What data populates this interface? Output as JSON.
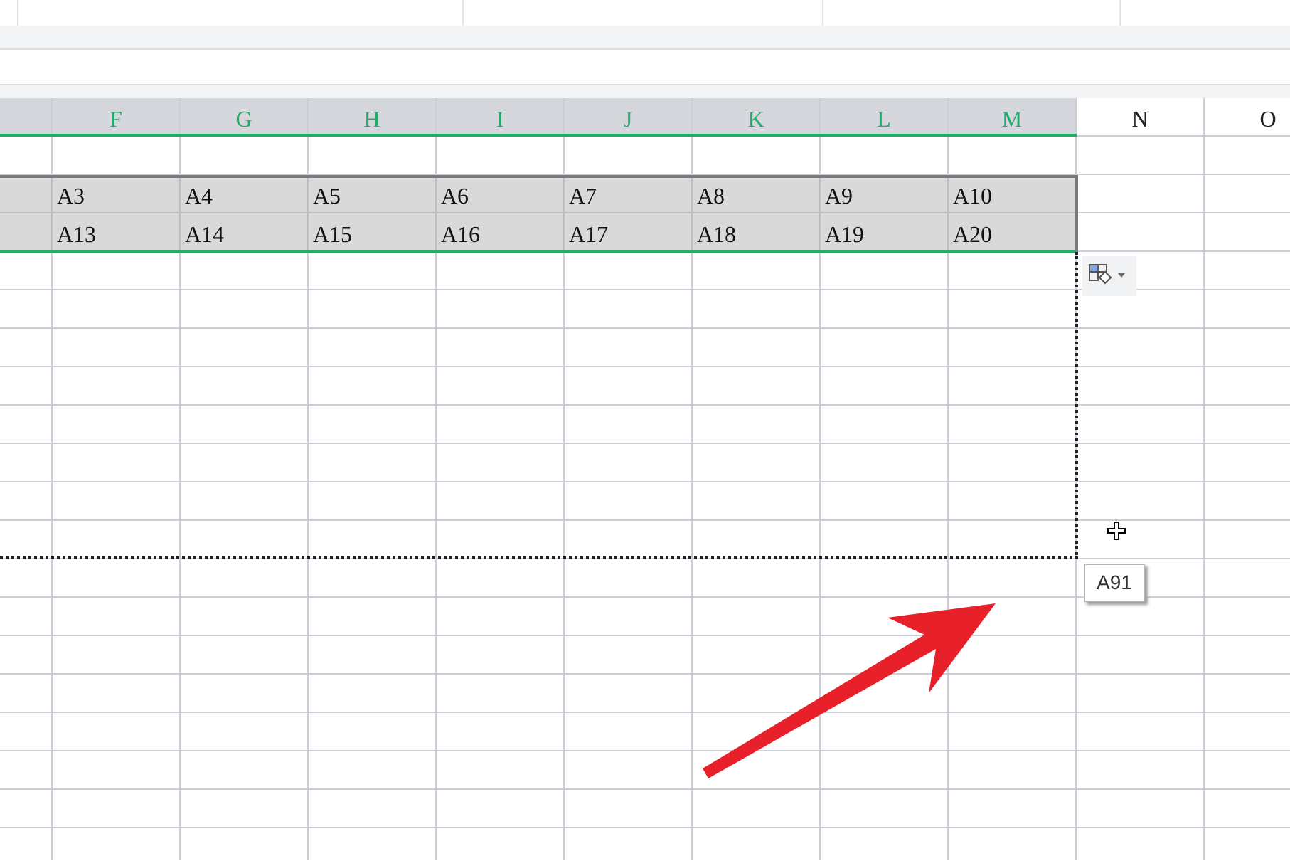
{
  "columns": [
    {
      "selected": true
    },
    {
      "label": "F",
      "selected": true
    },
    {
      "label": "G",
      "selected": true
    },
    {
      "label": "H",
      "selected": true
    },
    {
      "label": "I",
      "selected": true
    },
    {
      "label": "J",
      "selected": true
    },
    {
      "label": "K",
      "selected": true
    },
    {
      "label": "L",
      "selected": true
    },
    {
      "label": "M",
      "selected": true
    },
    {
      "label": "N",
      "selected": false
    },
    {
      "label": "O",
      "selected": false
    }
  ],
  "filled_rows": [
    {
      "selected": true,
      "cells": [
        "A3",
        "A4",
        "A5",
        "A6",
        "A7",
        "A8",
        "A9",
        "A10"
      ]
    },
    {
      "selected": true,
      "cells": [
        "A13",
        "A14",
        "A15",
        "A16",
        "A17",
        "A18",
        "A19",
        "A20"
      ]
    }
  ],
  "tooltip": {
    "text": "A91"
  }
}
